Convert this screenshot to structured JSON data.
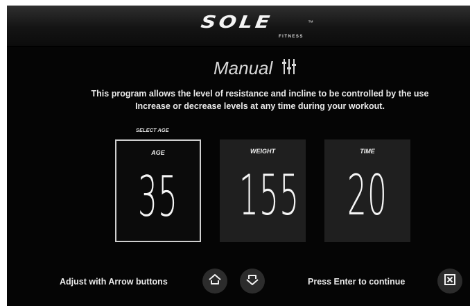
{
  "header": {
    "logo_text": "SOLE",
    "logo_tm": "™",
    "logo_subtext": "FITNESS"
  },
  "program": {
    "title": "Manual",
    "title_icon": "sliders-icon",
    "description_line1": "This program allows the level of resistance and incline to be controlled by the use",
    "description_line2": "Increase or decrease levels at any time during your workout."
  },
  "selection_prompt": "SELECT AGE",
  "cards": [
    {
      "label": "AGE",
      "value": "35",
      "selected": true
    },
    {
      "label": "WEIGHT",
      "value": "155",
      "selected": false
    },
    {
      "label": "TIME",
      "value": "20",
      "selected": false
    }
  ],
  "footer": {
    "adjust_text": "Adjust with Arrow buttons",
    "up_icon": "arrow-up-icon",
    "down_icon": "arrow-down-icon",
    "enter_text": "Press Enter to continue",
    "enter_icon": "enter-icon"
  },
  "colors": {
    "background": "#050505",
    "card": "#1f1f1f",
    "selected_border": "#cfcfcf",
    "text": "#eaeaea"
  }
}
